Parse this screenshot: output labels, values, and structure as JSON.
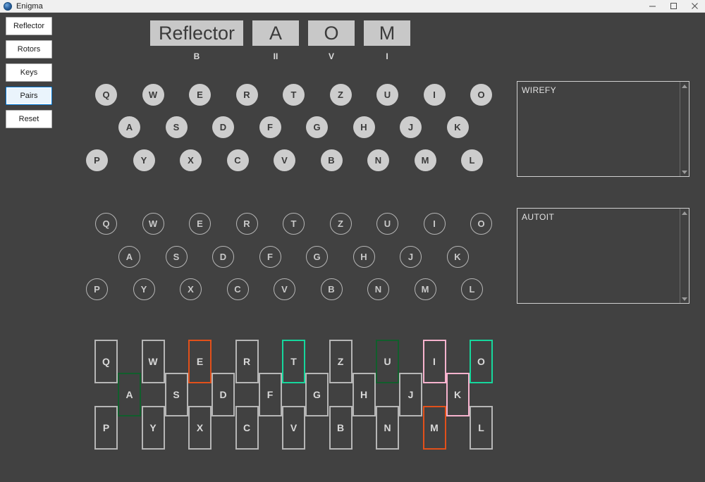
{
  "window": {
    "title": "Enigma",
    "icon": "app-circle-icon",
    "controls": {
      "minimize": "minimize-icon",
      "maximize": "maximize-icon",
      "close": "close-icon"
    }
  },
  "colors": {
    "background": "#414141",
    "titlebar": "#f0f0f0",
    "key_fill": "#cdcdcd",
    "key_outline": "#b6b6b6",
    "focus_accent": "#0078d7",
    "pair_green": "#115e2c",
    "pair_orange": "#e2501a",
    "pair_teal": "#16d79c",
    "pair_pink": "#f7b3ce"
  },
  "sidebar": {
    "buttons": [
      {
        "label": "Reflector",
        "focused": false
      },
      {
        "label": "Rotors",
        "focused": false
      },
      {
        "label": "Keys",
        "focused": false
      },
      {
        "label": "Pairs",
        "focused": true
      },
      {
        "label": "Reset",
        "focused": false
      }
    ]
  },
  "rotor_display": [
    {
      "window": "Reflector",
      "label": "B",
      "wide": true
    },
    {
      "window": "A",
      "label": "II",
      "wide": false
    },
    {
      "window": "O",
      "label": "V",
      "wide": false
    },
    {
      "window": "M",
      "label": "I",
      "wide": false
    }
  ],
  "keyboard": {
    "rows": [
      [
        "Q",
        "W",
        "E",
        "R",
        "T",
        "Z",
        "U",
        "I",
        "O"
      ],
      [
        "A",
        "S",
        "D",
        "F",
        "G",
        "H",
        "J",
        "K"
      ],
      [
        "P",
        "Y",
        "X",
        "C",
        "V",
        "B",
        "N",
        "M",
        "L"
      ]
    ]
  },
  "lampboard": {
    "rows": [
      [
        "Q",
        "W",
        "E",
        "R",
        "T",
        "Z",
        "U",
        "I",
        "O"
      ],
      [
        "A",
        "S",
        "D",
        "F",
        "G",
        "H",
        "J",
        "K"
      ],
      [
        "P",
        "Y",
        "X",
        "C",
        "V",
        "B",
        "N",
        "M",
        "L"
      ]
    ]
  },
  "textboxes": [
    {
      "name": "input-textbox",
      "value": "WIREFY"
    },
    {
      "name": "output-textbox",
      "value": "AUTOIT"
    }
  ],
  "plugboard": {
    "rows": [
      [
        "Q",
        "W",
        "E",
        "R",
        "T",
        "Z",
        "U",
        "I",
        "O"
      ],
      [
        "A",
        "S",
        "D",
        "F",
        "G",
        "H",
        "J",
        "K"
      ],
      [
        "P",
        "Y",
        "X",
        "C",
        "V",
        "B",
        "N",
        "M",
        "L"
      ]
    ],
    "pair_colors": {
      "A": "#115e2c",
      "U": "#115e2c",
      "E": "#e2501a",
      "M": "#e2501a",
      "T": "#16d79c",
      "O": "#16d79c",
      "I": "#f7b3ce",
      "K": "#f7b3ce"
    },
    "pairs": [
      {
        "a": "A",
        "b": "U",
        "color": "#115e2c"
      },
      {
        "a": "E",
        "b": "M",
        "color": "#e2501a"
      },
      {
        "a": "T",
        "b": "O",
        "color": "#16d79c"
      },
      {
        "a": "I",
        "b": "K",
        "color": "#f7b3ce"
      }
    ]
  }
}
